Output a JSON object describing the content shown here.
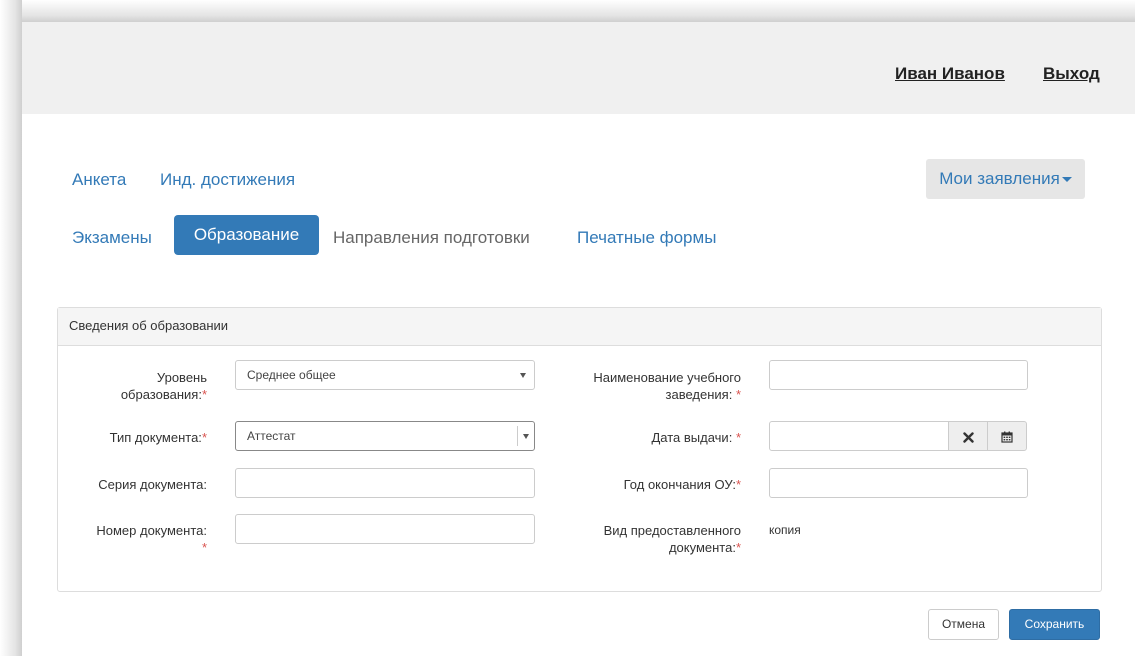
{
  "header": {
    "user_name": "Иван Иванов",
    "logout_label": "Выход"
  },
  "nav": {
    "row1": [
      "Анкета",
      "Инд. достижения"
    ],
    "my_applications": "Мои заявления",
    "row2": [
      "Экзамены",
      "Образование",
      "Направления подготовки",
      "Печатные формы"
    ]
  },
  "panel": {
    "title": "Сведения об образовании",
    "fields": {
      "education_level": {
        "label_line1": "Уровень",
        "label_line2": "образования:",
        "required": "*",
        "value": "Среднее общее"
      },
      "document_type": {
        "label": "Тип документа:",
        "required": "*",
        "value": "Аттестат"
      },
      "document_series": {
        "label": "Серия документа:",
        "value": ""
      },
      "document_number": {
        "label": "Номер документа:",
        "required": "*",
        "value": ""
      },
      "institution_name": {
        "label_line1": "Наименование учебного",
        "label_line2": "заведения:",
        "required": "*",
        "value": ""
      },
      "issue_date": {
        "label": "Дата выдачи:",
        "required": "*",
        "value": ""
      },
      "graduation_year": {
        "label": "Год окончания ОУ:",
        "required": "*",
        "value": ""
      },
      "document_kind": {
        "label_line1": "Вид предоставленного",
        "label_line2": "документа:",
        "required": "*",
        "value": "копия"
      }
    }
  },
  "buttons": {
    "cancel": "Отмена",
    "save": "Сохранить"
  },
  "icons": {
    "clear": "close-icon",
    "calendar": "calendar-icon"
  },
  "colors": {
    "primary": "#337ab7",
    "required": "#d9534f",
    "header_bg": "#f0f0f0"
  }
}
